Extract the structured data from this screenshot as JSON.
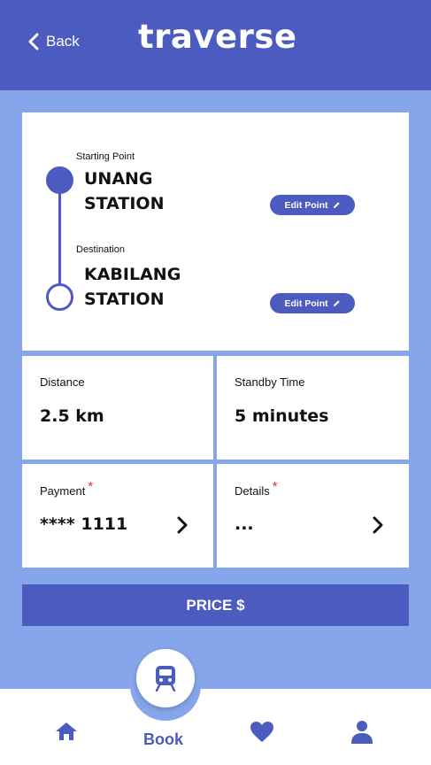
{
  "header": {
    "back_label": "Back",
    "logo": "traverse"
  },
  "route": {
    "start_label": "Starting Point",
    "start_line1": "UNANG",
    "start_line2": "STATION",
    "dest_label": "Destination",
    "dest_line1": "KABILANG",
    "dest_line2": "STATION",
    "edit_label": "Edit Point"
  },
  "info": {
    "distance_label": "Distance",
    "distance_value": "2.5 km",
    "standby_label": "Standby Time",
    "standby_value": "5 minutes",
    "payment_label": "Payment",
    "payment_value": "**** 1111",
    "details_label": "Details",
    "details_value": "...",
    "required_mark": "*"
  },
  "price_button": "PRICE $",
  "nav": {
    "book_label": "Book"
  },
  "colors": {
    "primary": "#4c5bbf",
    "background": "#86a5ea",
    "required": "#e03030"
  },
  "icons": [
    "chevron-left-icon",
    "pencil-icon",
    "chevron-right-icon",
    "train-icon",
    "home-icon",
    "heart-icon",
    "user-icon"
  ]
}
